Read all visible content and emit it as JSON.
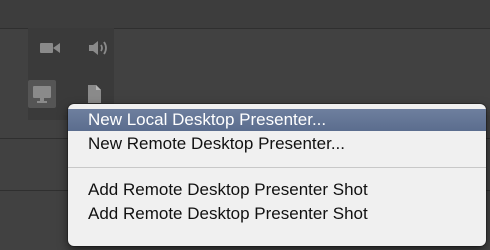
{
  "toolbar": {
    "icons": [
      "camera-icon",
      "speaker-icon",
      "monitor-icon",
      "document-icon"
    ],
    "selected": "monitor-icon"
  },
  "menu": {
    "items": [
      {
        "label": "New Local Desktop Presenter...",
        "highlighted": true
      },
      {
        "label": "New Remote Desktop Presenter...",
        "highlighted": false
      },
      {
        "label": "Add Remote Desktop Presenter Shot",
        "highlighted": false
      },
      {
        "label": "Add Remote Desktop Presenter Shot",
        "highlighted": false
      }
    ]
  },
  "colors": {
    "background": "#414141",
    "menu_background": "#f0f0f0",
    "highlight": "#6377a0",
    "icon": "#8a8a8a"
  }
}
